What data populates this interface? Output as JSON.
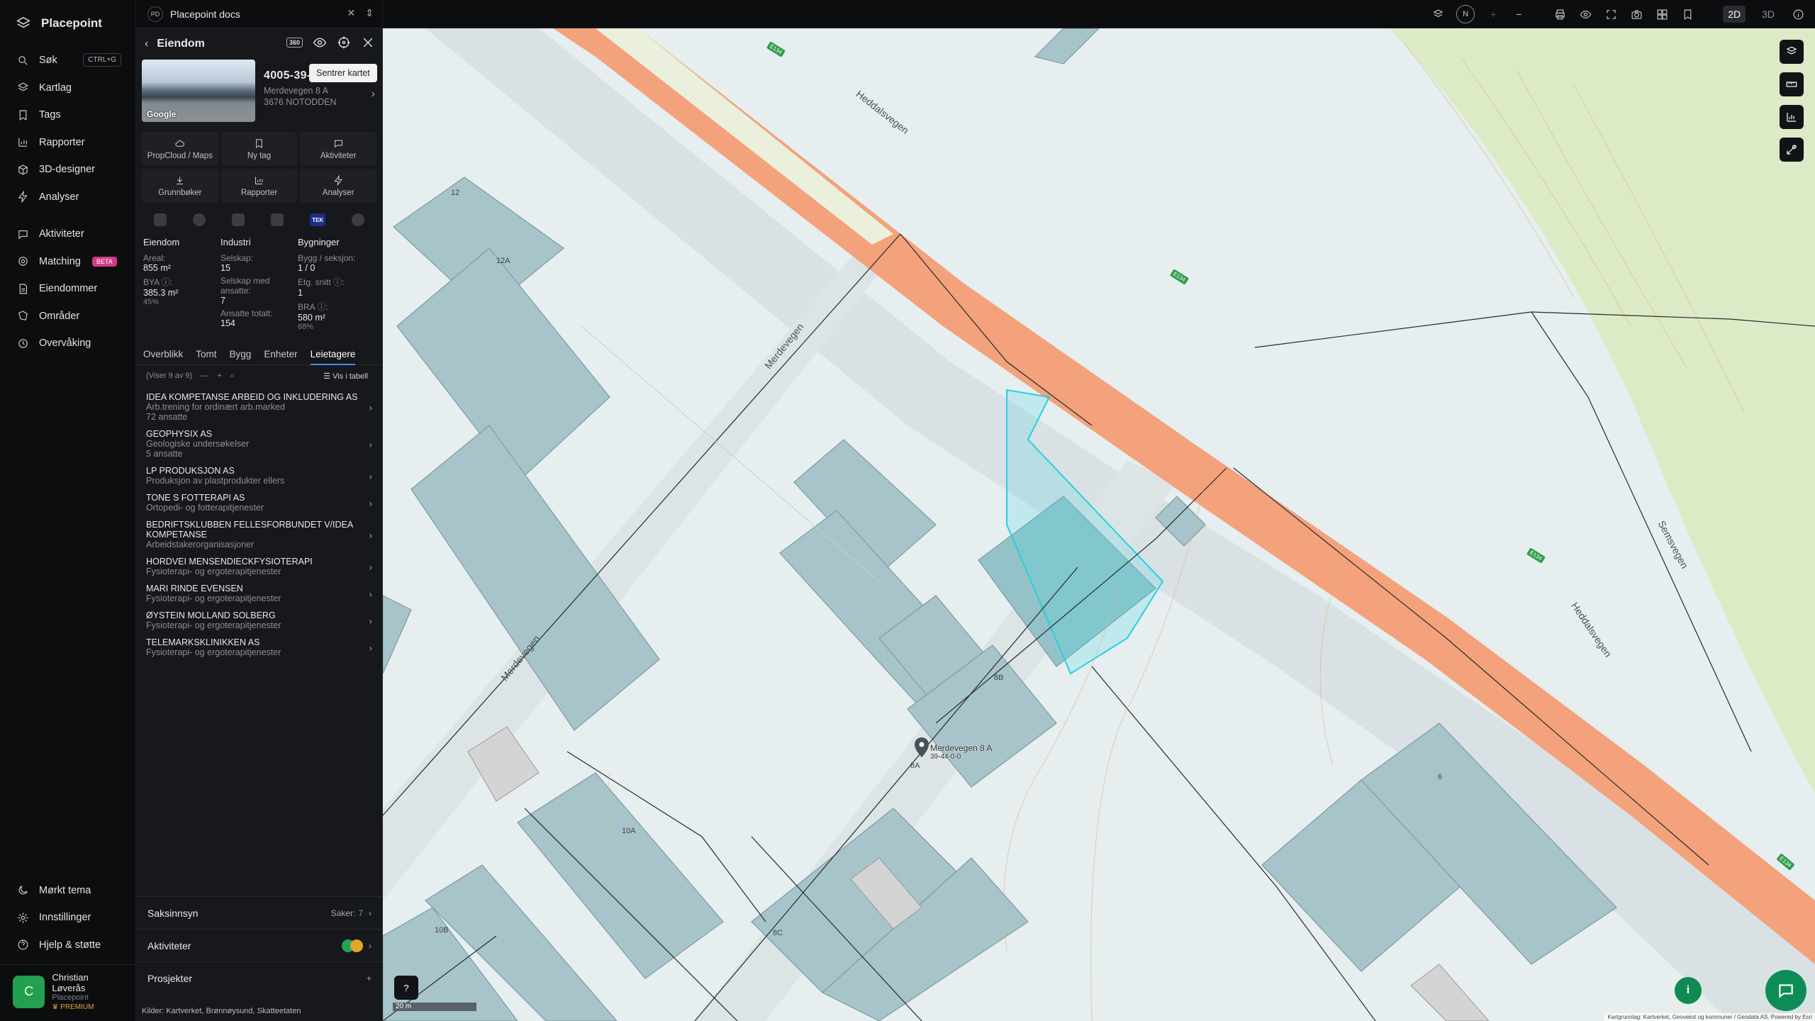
{
  "app": {
    "name": "Placepoint"
  },
  "nav": {
    "items": [
      {
        "label": "Søk",
        "icon": "search-icon",
        "kbd": "CTRL+G"
      },
      {
        "label": "Kartlag",
        "icon": "layers-icon"
      },
      {
        "label": "Tags",
        "icon": "bookmark-icon"
      },
      {
        "label": "Rapporter",
        "icon": "bar-chart-icon"
      },
      {
        "label": "3D-designer",
        "icon": "cube-icon"
      },
      {
        "label": "Analyser",
        "icon": "bolt-icon"
      }
    ],
    "items2": [
      {
        "label": "Aktiviteter",
        "icon": "chat-icon"
      },
      {
        "label": "Matching",
        "icon": "target-icon",
        "badge": "BETA"
      },
      {
        "label": "Eiendommer",
        "icon": "document-icon"
      },
      {
        "label": "Områder",
        "icon": "area-icon"
      },
      {
        "label": "Overvåking",
        "icon": "monitor-icon"
      }
    ],
    "bottom": [
      {
        "label": "Mørkt tema",
        "icon": "moon-icon"
      },
      {
        "label": "Innstillinger",
        "icon": "gear-icon"
      },
      {
        "label": "Hjelp & støtte",
        "icon": "help-icon"
      }
    ],
    "user": {
      "initial": "C",
      "name": "Christian Løverås",
      "org": "Placepoint",
      "plan": "PREMIUM"
    }
  },
  "doc_tab": {
    "badge": "PD",
    "title": "Placepoint docs"
  },
  "view_modes": [
    "2D",
    "3D"
  ],
  "compass": "N",
  "panel": {
    "title": "Eiendom",
    "tooltip": "Sentrer kartet",
    "badge360": "360",
    "property": {
      "id": "4005-39-44-0-0",
      "address": "Merdevegen 8 A",
      "postal": "3676 NOTODDEN",
      "photo_label": "Google"
    },
    "actions": [
      {
        "label": "PropCloud / Maps",
        "icon": "cloud-icon"
      },
      {
        "label": "Ny tag",
        "icon": "bookmark-icon"
      },
      {
        "label": "Aktiviteter",
        "icon": "chat-icon"
      },
      {
        "label": "Grunnbøker",
        "icon": "download-icon"
      },
      {
        "label": "Rapporter",
        "icon": "bar-chart-icon"
      },
      {
        "label": "Analyser",
        "icon": "bolt-icon"
      }
    ],
    "layer_badge": "TEK",
    "stats": {
      "eiendom": {
        "title": "Eiendom",
        "areal_label": "Areal:",
        "areal": "855 m²",
        "bya_label": "BYA ⓘ:",
        "bya": "385.3 m²",
        "bya_pct": "45%"
      },
      "industri": {
        "title": "Industri",
        "selskap_label": "Selskap:",
        "selskap": "15",
        "ansatte_label": "Selskap med ansatte:",
        "ansatte": "7",
        "totalt_label": "Ansatte totalt:",
        "totalt": "154"
      },
      "bygninger": {
        "title": "Bygninger",
        "bygg_label": "Bygg / seksjon:",
        "bygg": "1 / 0",
        "etg_label": "Etg. snitt ⓘ:",
        "etg": "1",
        "bra_label": "BRA ⓘ:",
        "bra": "580 m²",
        "bra_pct": "68%"
      }
    },
    "tabs": [
      "Overblikk",
      "Tomt",
      "Bygg",
      "Enheter",
      "Leietagere"
    ],
    "active_tab": "Leietagere",
    "list_count": "(Viser 9 av 9)",
    "vis_tabell": "Vis i tabell",
    "tenants": [
      {
        "name": "IDEA KOMPETANSE ARBEID OG INKLUDERING AS",
        "desc": "Arb.trening for ordinært arb.marked",
        "emp": "72 ansatte"
      },
      {
        "name": "GEOPHYSIX AS",
        "desc": "Geologiske undersøkelser",
        "emp": "5 ansatte"
      },
      {
        "name": "LP PRODUKSJON AS",
        "desc": "Produksjon av plastprodukter ellers",
        "emp": ""
      },
      {
        "name": "TONE S FOTTERAPI AS",
        "desc": "Ortopedi- og fotterapitjenester",
        "emp": ""
      },
      {
        "name": "BEDRIFTSKLUBBEN FELLESFORBUNDET V/IDEA KOMPETANSE",
        "desc": "Arbeidstakerorganisasjoner",
        "emp": ""
      },
      {
        "name": "HORDVEI MENSENDIECKFYSIOTERAPI",
        "desc": "Fysioterapi- og ergoterapitjenester",
        "emp": ""
      },
      {
        "name": "MARI RINDE EVENSEN",
        "desc": "Fysioterapi- og ergoterapitjenester",
        "emp": ""
      },
      {
        "name": "ØYSTEIN MOLLAND SOLBERG",
        "desc": "Fysioterapi- og ergoterapitjenester",
        "emp": ""
      },
      {
        "name": "TELEMARKSKLINIKKEN AS",
        "desc": "Fysioterapi- og ergoterapitjenester",
        "emp": ""
      }
    ],
    "sections": {
      "saksinnsyn": "Saksinnsyn",
      "saker_label": "Saker:",
      "saker": "7",
      "aktiviteter": "Aktiviteter",
      "prosjekter": "Prosjekter"
    },
    "sources_label": "Kilder:",
    "sources": [
      "Kartverket",
      "Brønnøysund",
      "Skatteetaten"
    ]
  },
  "map": {
    "road_labels": [
      "Heddalsvegen",
      "Merdevegen",
      "Merdevegen",
      "Heddalsvegen",
      "Semsvegen"
    ],
    "route_shields": [
      "E134",
      "E134",
      "E134",
      "E134"
    ],
    "building_labels": [
      "12",
      "12A",
      "8B",
      "8A",
      "10A",
      "8C",
      "10B",
      "6"
    ],
    "marker_label": "Merdevegen 8 A",
    "marker_sub": "39-44-0-0",
    "scale": "20 m",
    "attribution": "Kartgrunnlag: Kartverket, Geovekst og kommuner / Geodata AS. Powered by Esri"
  }
}
